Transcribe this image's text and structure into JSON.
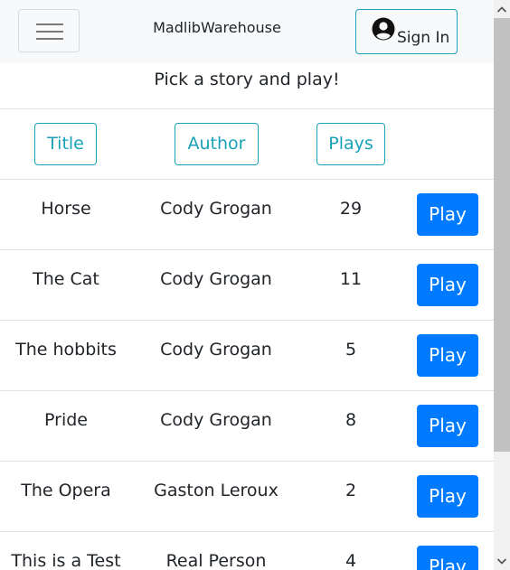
{
  "navbar": {
    "brand": "MadlibWarehouse",
    "signin_label": "Sign In",
    "menu_icon": "hamburger-menu-icon",
    "user_icon": "user-circle-icon"
  },
  "subtitle": "Pick a story and play!",
  "sort_buttons": {
    "title": "Title",
    "author": "Author",
    "plays": "Plays"
  },
  "stories": [
    {
      "title": "Horse",
      "author": "Cody Grogan",
      "plays": "29",
      "action": "Play"
    },
    {
      "title": "The Cat",
      "author": "Cody Grogan",
      "plays": "11",
      "action": "Play"
    },
    {
      "title": "The hobbits",
      "author": "Cody Grogan",
      "plays": "5",
      "action": "Play"
    },
    {
      "title": "Pride",
      "author": "Cody Grogan",
      "plays": "8",
      "action": "Play"
    },
    {
      "title": "The Opera",
      "author": "Gaston Leroux",
      "plays": "2",
      "action": "Play"
    },
    {
      "title": "This is a Test",
      "author": "Real Person",
      "plays": "4",
      "action": "Play"
    }
  ],
  "colors": {
    "navbar_bg": "#f8f9fa",
    "outline_accent": "#17a2b8",
    "primary": "#007bff"
  }
}
